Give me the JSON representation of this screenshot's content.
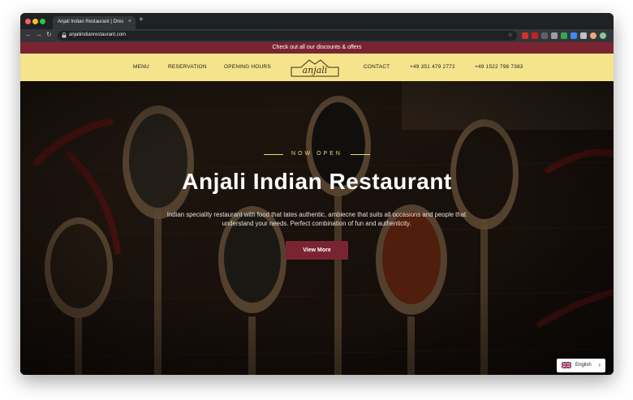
{
  "browser": {
    "tab_title": "Anjali Indian Restaurant | Dres",
    "tab_close": "×",
    "new_tab": "+",
    "url": "anjaliindianrestaurant.com",
    "back": "←",
    "forward": "→",
    "reload": "↻",
    "lock": "🔒",
    "star": "☆"
  },
  "promo_bar": {
    "text": "Check out all our discounts & offers"
  },
  "nav": {
    "menu": "MENU",
    "reservation": "RESERVATION",
    "opening_hours": "OPENING HOURS",
    "logo": "anjali",
    "contact": "CONTACT",
    "phone_1": "+49 351 479 2772",
    "phone_2": "+49 1522 798 7383"
  },
  "hero": {
    "eyebrow": "NOW OPEN",
    "title": "Anjali Indian Restaurant",
    "description": "Indian speciality restaurant with food that tates authentic, ambiecne that suits all occasions and people that understand your needs. Perfect combination of fun and authenticity.",
    "cta": "View More"
  },
  "language": {
    "label": "English",
    "chevron": "›"
  },
  "colors": {
    "promo_bg": "#7a2432",
    "nav_bg": "#f6e48c",
    "accent_gold": "#e9d879",
    "cta_bg": "#7a2432"
  }
}
